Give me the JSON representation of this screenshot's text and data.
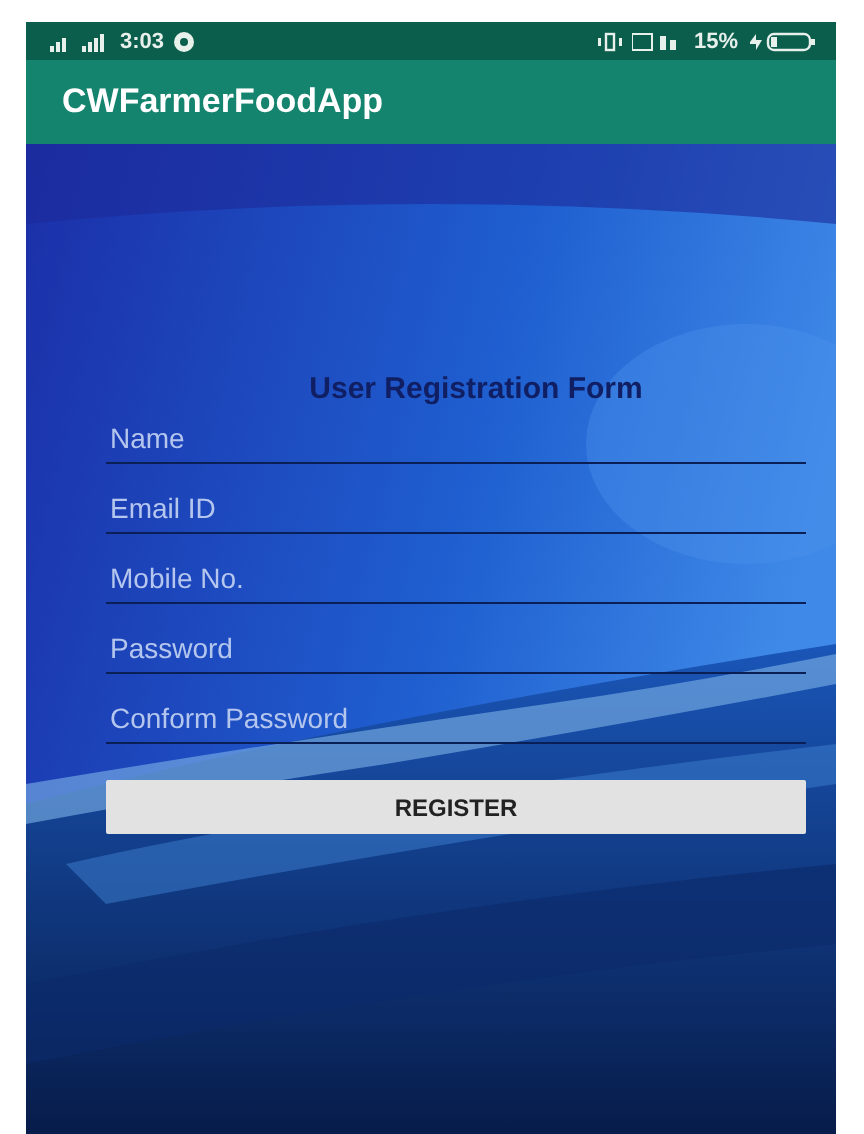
{
  "status_bar": {
    "time": "3:03",
    "battery": "15%"
  },
  "app_bar": {
    "title": "CWFarmerFoodApp"
  },
  "form": {
    "title": "User Registration Form",
    "fields": [
      {
        "placeholder": "Name"
      },
      {
        "placeholder": "Email ID"
      },
      {
        "placeholder": "Mobile No."
      },
      {
        "placeholder": "Password"
      },
      {
        "placeholder": "Conform Password"
      }
    ],
    "button": "REGISTER"
  }
}
